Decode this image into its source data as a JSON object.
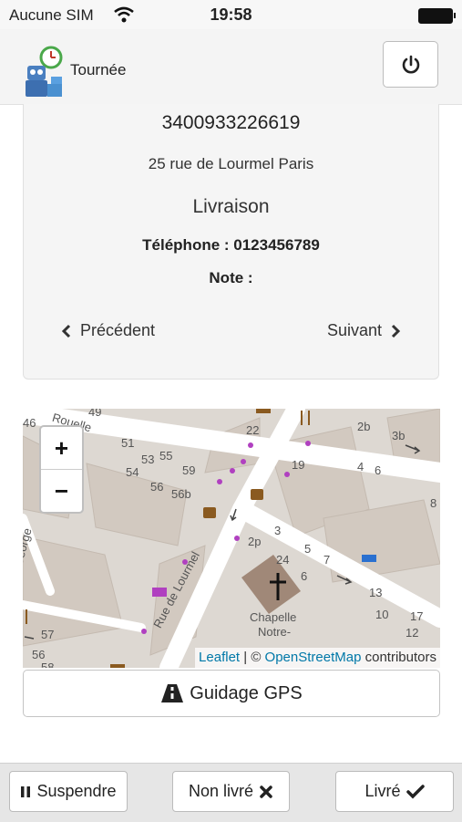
{
  "status_bar": {
    "carrier": "Aucune SIM",
    "time": "19:58"
  },
  "header": {
    "title": "Tournée"
  },
  "delivery": {
    "barcode": "3400933226619",
    "address": "25 rue de Lourmel Paris",
    "type": "Livraison",
    "phone": "Téléphone : 0123456789",
    "note": "Note :",
    "prev_label": "Précédent",
    "next_label": "Suivant"
  },
  "map": {
    "zoom_in": "+",
    "zoom_out": "−",
    "attribution": {
      "leaflet": "Leaflet",
      "sep": " | © ",
      "osm": "OpenStreetMap",
      "suffix": " contributors"
    },
    "streets": [
      "Rue de Lourmel",
      "Rouelle",
      "George"
    ],
    "landmarks": [
      "Chapelle",
      "Notre-"
    ],
    "house_numbers": [
      "49",
      "51",
      "53",
      "55",
      "54",
      "56",
      "56b",
      "59",
      "22",
      "19",
      "2b",
      "3b",
      "4",
      "6",
      "8",
      "2p",
      "3",
      "24",
      "5",
      "7",
      "6",
      "13",
      "10",
      "17",
      "12",
      "57",
      "56",
      "58",
      "1",
      "46",
      "7"
    ]
  },
  "actions": {
    "gps": "Guidage GPS",
    "suspend": "Suspendre",
    "not_delivered": "Non livré",
    "delivered": "Livré"
  }
}
